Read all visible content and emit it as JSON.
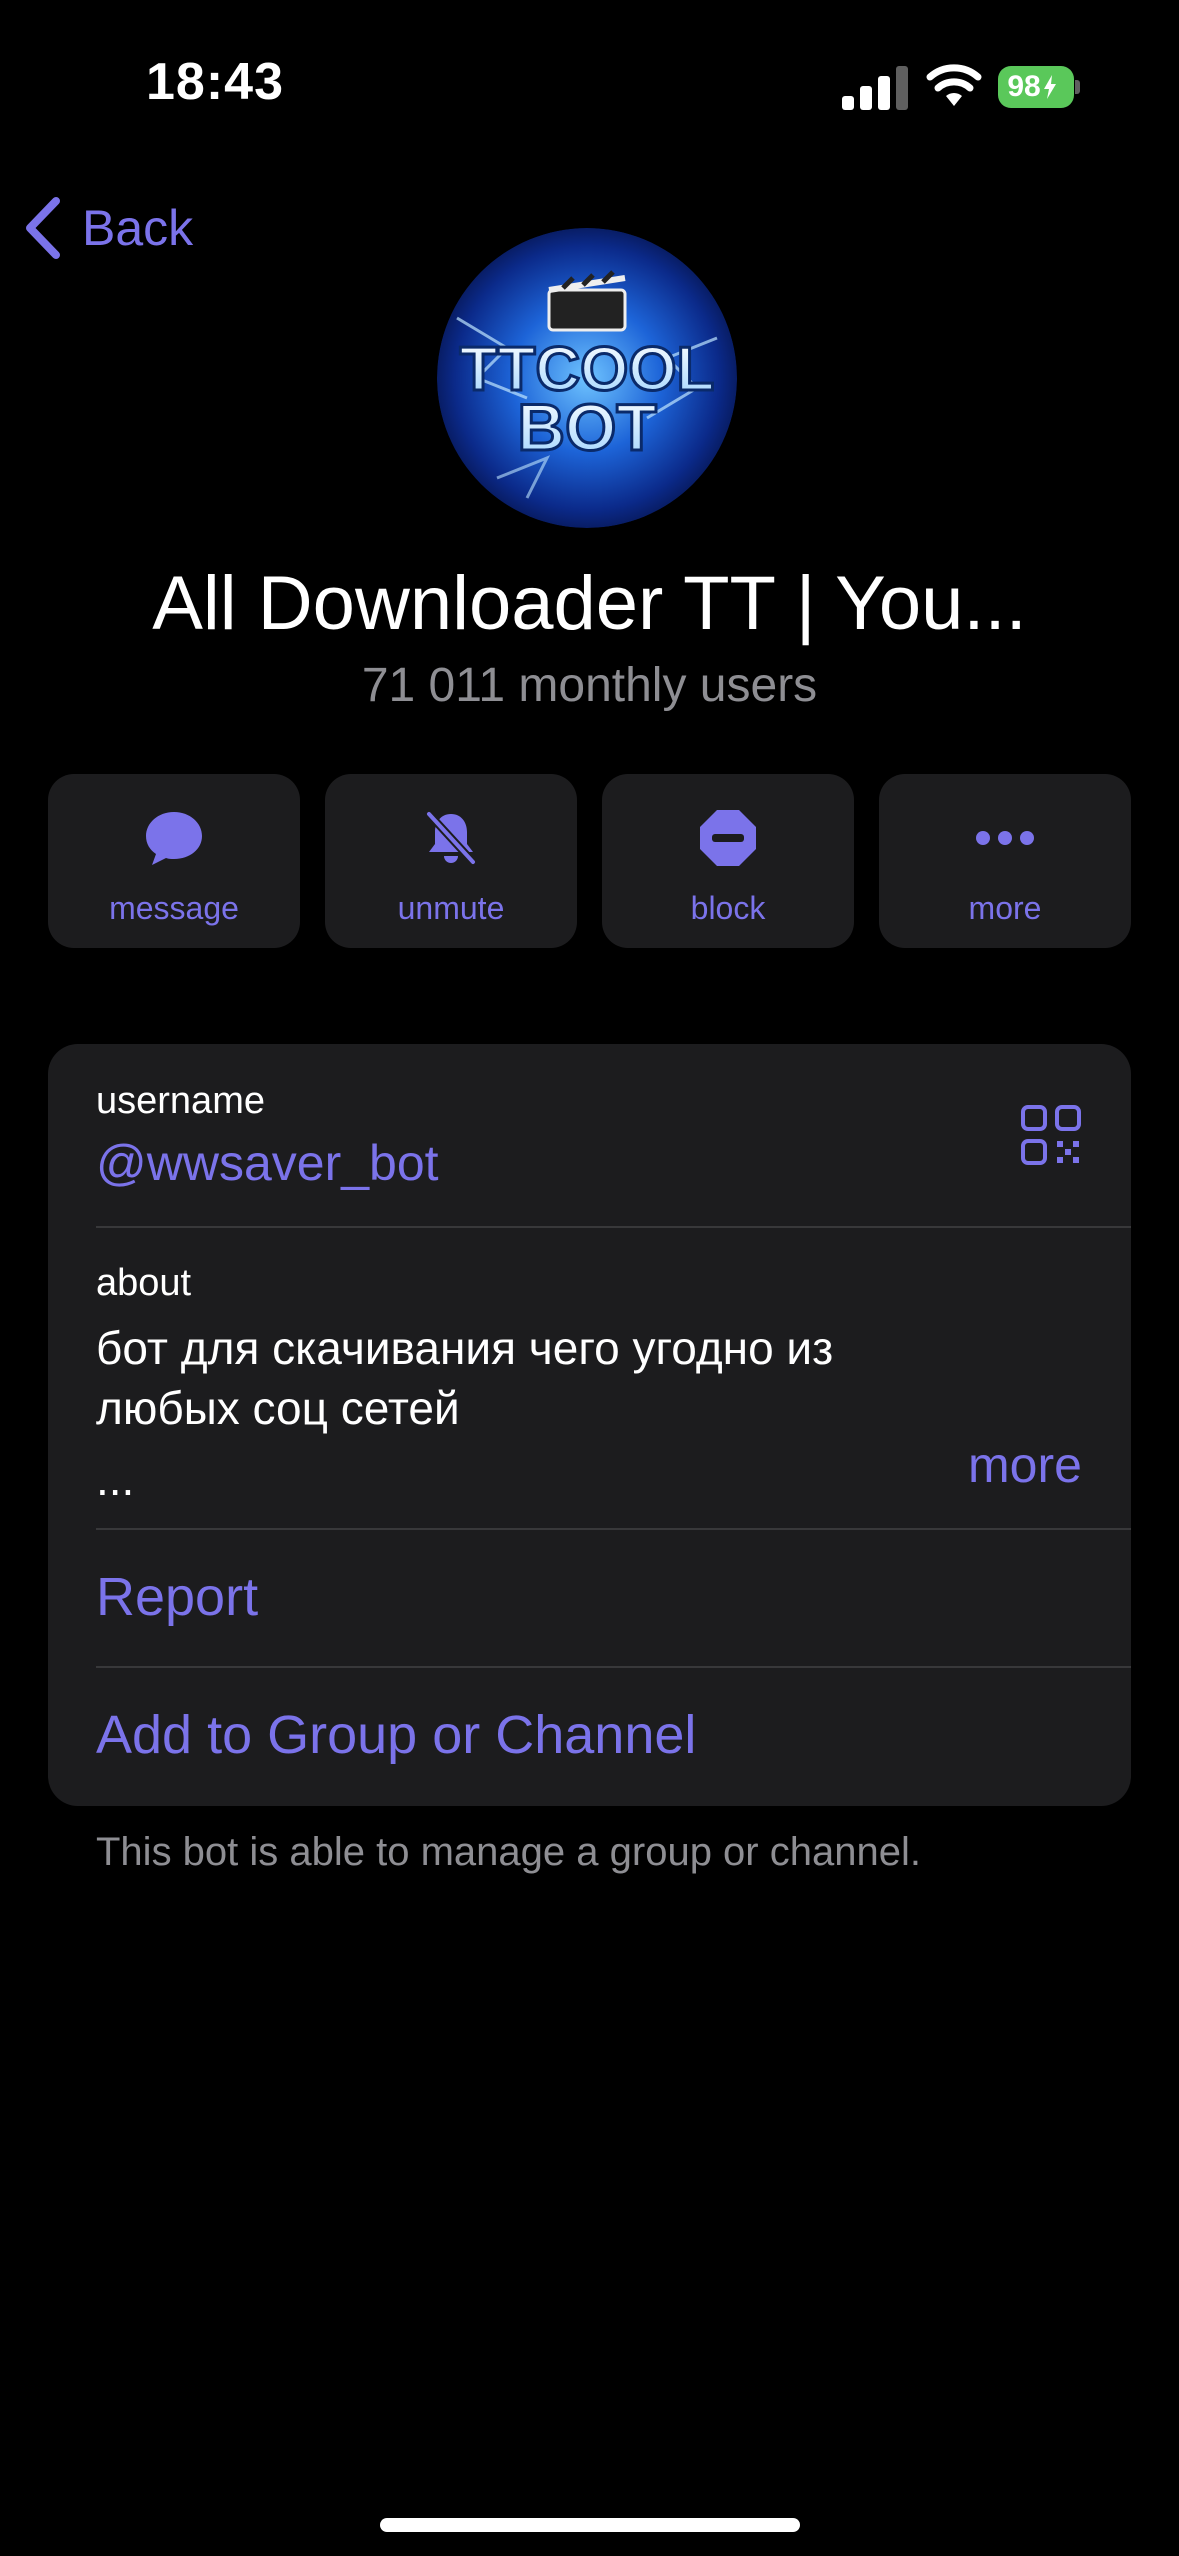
{
  "status_bar": {
    "time": "18:43",
    "battery": "98",
    "battery_color": "#5ac85a",
    "icons": [
      "signal-icon",
      "wifi-icon",
      "battery-charging-icon"
    ]
  },
  "nav": {
    "back_label": "Back"
  },
  "profile": {
    "avatar_text_line1": "TTCOOL",
    "avatar_text_line2": "BOT",
    "name": "All Downloader TT | You...",
    "subtitle": "71 011 monthly users"
  },
  "actions": [
    {
      "label": "message",
      "icon": "chat-bubble-icon"
    },
    {
      "label": "unmute",
      "icon": "bell-slash-icon"
    },
    {
      "label": "block",
      "icon": "block-icon"
    },
    {
      "label": "more",
      "icon": "ellipsis-icon"
    }
  ],
  "info": {
    "username_label": "username",
    "username_value": "@wwsaver_bot",
    "about_label": "about",
    "about_line1": "бот для скачивания чего угодно из",
    "about_line2": "любых соц сетей",
    "about_ellipsis": "...",
    "about_more": "more",
    "report": "Report",
    "add_to_group": "Add to Group or Channel"
  },
  "footnote": "This bot is able to manage a group or channel.",
  "accent_color": "#7b73ea"
}
